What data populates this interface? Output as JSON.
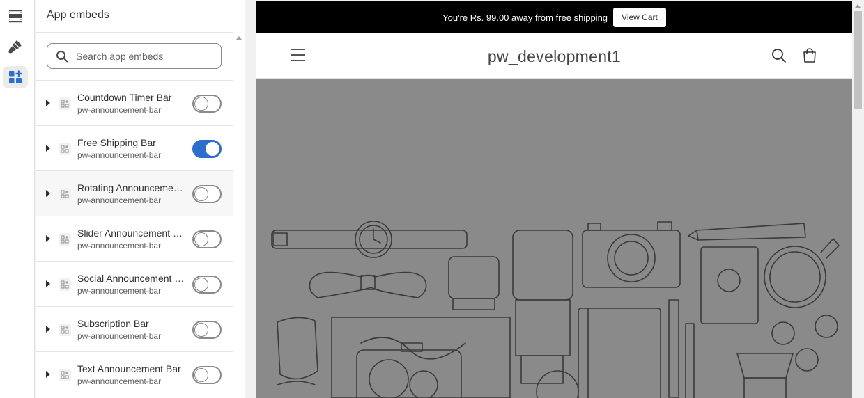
{
  "rail": {
    "items": [
      {
        "icon": "sections-icon",
        "active": false
      },
      {
        "icon": "brush-icon",
        "active": false
      },
      {
        "icon": "app-embeds-icon",
        "active": true
      }
    ]
  },
  "panel": {
    "title": "App embeds",
    "search": {
      "placeholder": "Search app embeds",
      "value": ""
    },
    "items": [
      {
        "title": "Countdown Timer Bar",
        "subtitle": "pw-announcement-bar",
        "enabled": false
      },
      {
        "title": "Free Shipping Bar",
        "subtitle": "pw-announcement-bar",
        "enabled": true
      },
      {
        "title": "Rotating Announcement Bar",
        "subtitle": "pw-announcement-bar",
        "enabled": false
      },
      {
        "title": "Slider Announcement Bar",
        "subtitle": "pw-announcement-bar",
        "enabled": false
      },
      {
        "title": "Social Announcement Bar",
        "subtitle": "pw-announcement-bar",
        "enabled": false
      },
      {
        "title": "Subscription Bar",
        "subtitle": "pw-announcement-bar",
        "enabled": false
      },
      {
        "title": "Text Announcement Bar",
        "subtitle": "pw-announcement-bar",
        "enabled": false
      }
    ]
  },
  "preview": {
    "announcement": {
      "text": "You're Rs. 99.00 away from free shipping",
      "button": "View Cart",
      "background": "#000000"
    },
    "header": {
      "brand": "pw_development1",
      "icons": [
        "menu-icon",
        "search-icon",
        "cart-icon"
      ]
    },
    "hero": {
      "background": "#8a8a8a",
      "illustration": "travel-gear-line-art"
    }
  },
  "colors": {
    "accent": "#2c6ecb",
    "text": "#303030",
    "muted": "#616161"
  }
}
